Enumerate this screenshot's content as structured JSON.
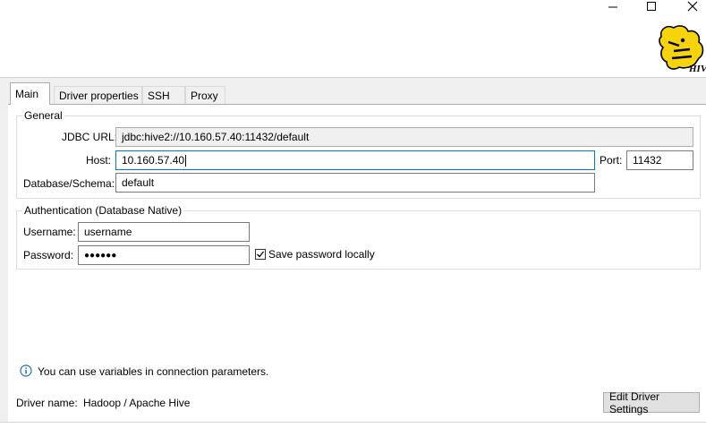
{
  "window": {
    "minimize_glyph": "—",
    "maximize_glyph": "☐",
    "close_glyph": "✕",
    "logo_text": "HIVE"
  },
  "tabs": [
    {
      "label": "Main",
      "active": true
    },
    {
      "label": "Driver properties",
      "active": false
    },
    {
      "label": "SSH",
      "active": false
    },
    {
      "label": "Proxy",
      "active": false
    }
  ],
  "general": {
    "legend": "General",
    "jdbc_label": "JDBC URL:",
    "jdbc_value": "jdbc:hive2://10.160.57.40:11432/default",
    "host_label": "Host:",
    "host_value": "10.160.57.40",
    "port_label": "Port:",
    "port_value": "11432",
    "db_label": "Database/Schema:",
    "db_value": "default"
  },
  "auth": {
    "legend": "Authentication (Database Native)",
    "username_label": "Username:",
    "username_value": "username",
    "password_label": "Password:",
    "password_value": "●●●●●●",
    "save_password_label": "Save password locally",
    "save_password_checked": true
  },
  "info": {
    "icon": "info-icon",
    "text": "You can use variables in connection parameters."
  },
  "driver": {
    "label": "Driver name:",
    "value": "Hadoop / Apache Hive",
    "edit_button": "Edit Driver Settings"
  },
  "colors": {
    "accent": "#0078d7",
    "logo_yellow": "#f6d40b",
    "panel_bg": "#f0f0f0"
  }
}
